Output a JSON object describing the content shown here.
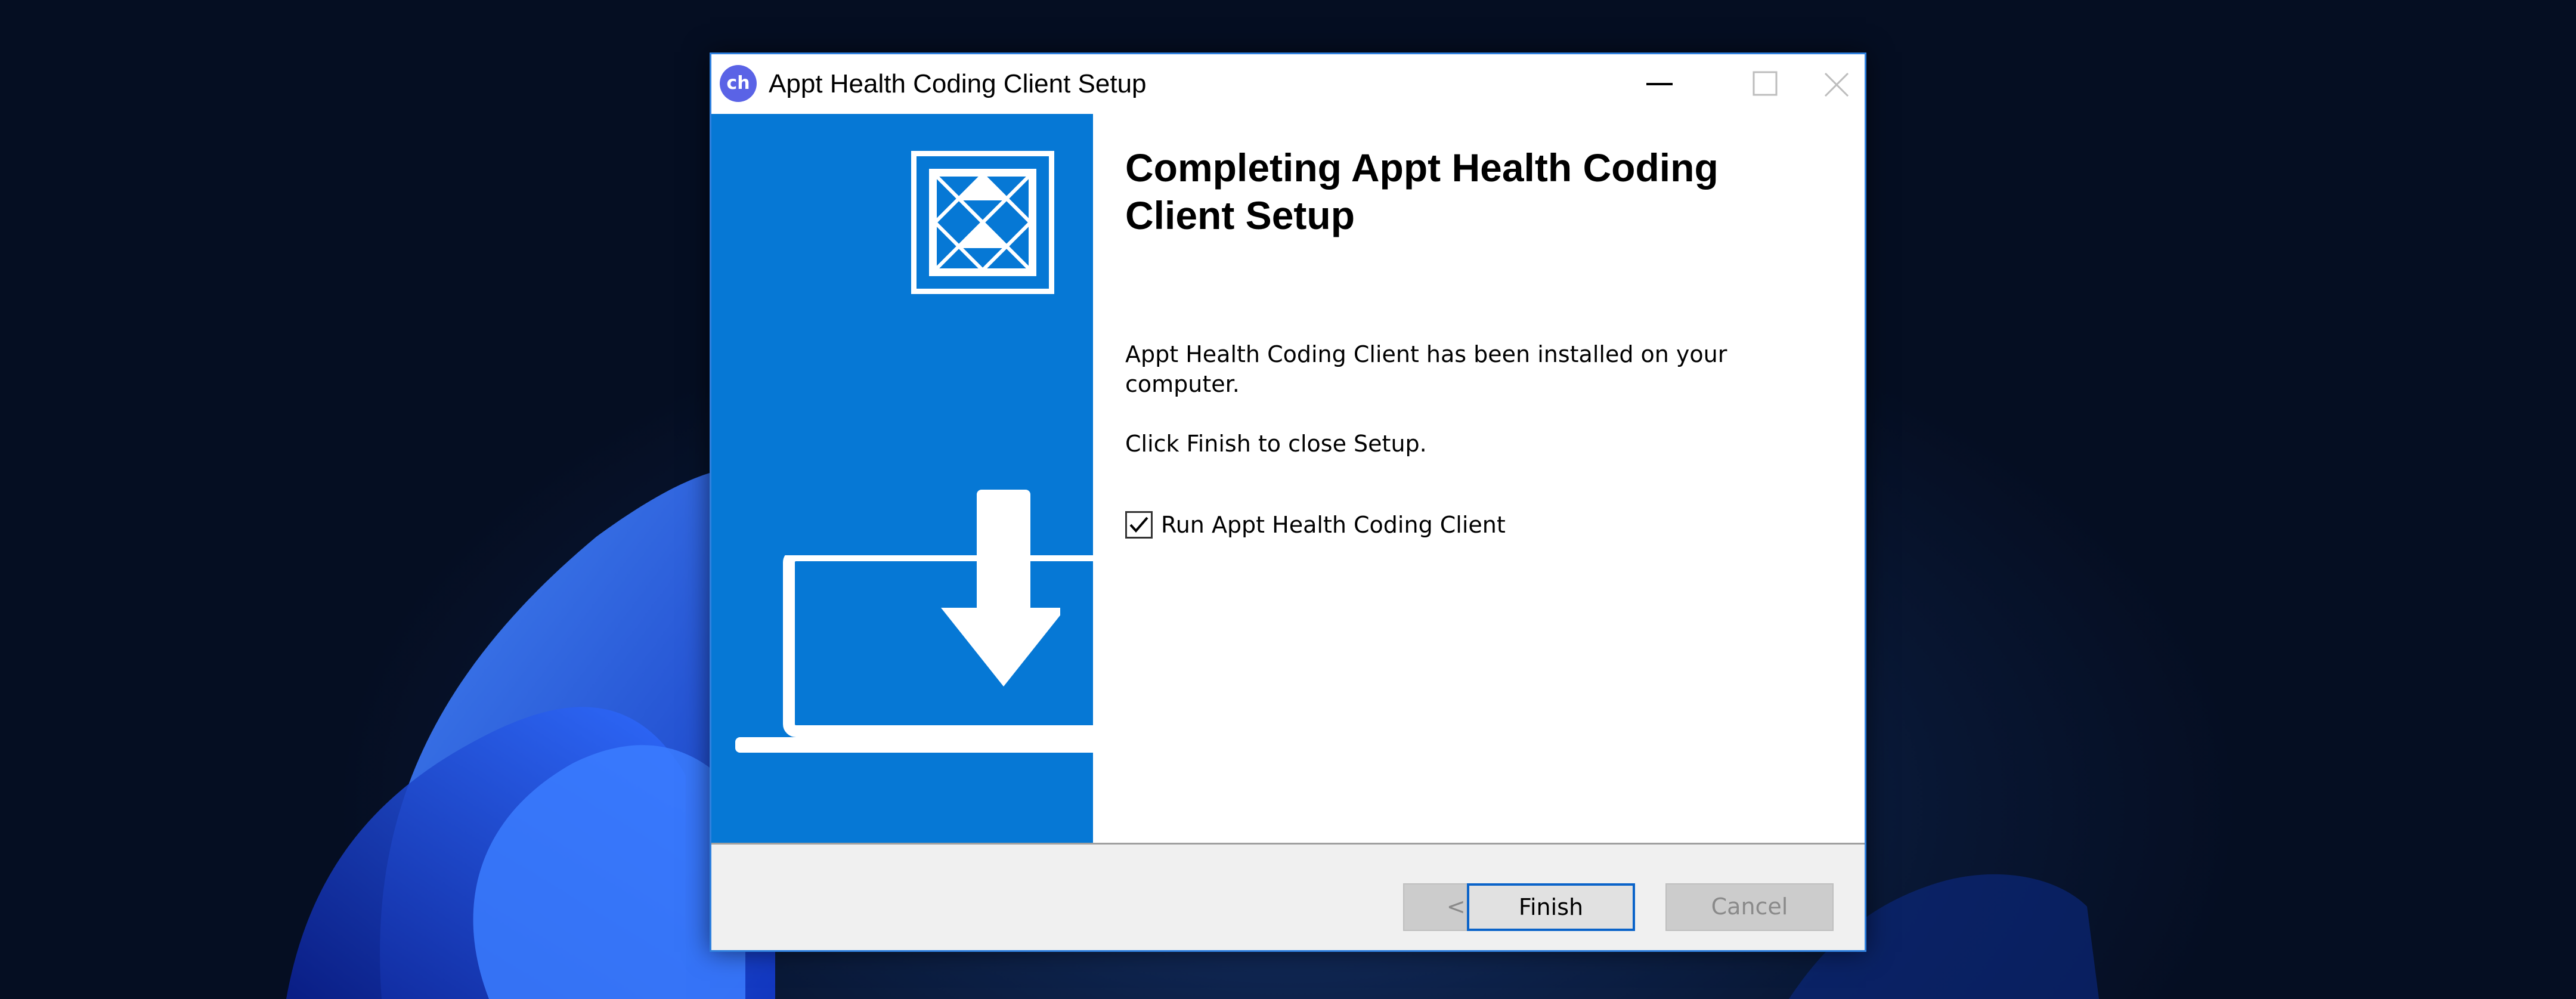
{
  "window": {
    "title": "Appt Health Coding Client Setup",
    "app_icon_text": "ch",
    "icon_names": [
      "minimize-icon",
      "maximize-icon",
      "close-icon"
    ]
  },
  "banner": {
    "icon_names": [
      "app-logo-icon",
      "download-arrow-icon",
      "laptop-icon"
    ],
    "color": "#0678d5"
  },
  "content": {
    "heading": "Completing Appt Health Coding Client Setup",
    "installed_message": "Appt Health Coding Client has been installed on your computer.",
    "finish_instruction": "Click Finish to close Setup.",
    "run_option": {
      "label": "Run Appt Health Coding Client",
      "checked": true
    }
  },
  "buttons": {
    "back": "< Back",
    "finish": "Finish",
    "cancel": "Cancel"
  },
  "colors": {
    "accent": "#2f80de",
    "focus_border": "#0a63c9",
    "banner": "#0678d5"
  }
}
